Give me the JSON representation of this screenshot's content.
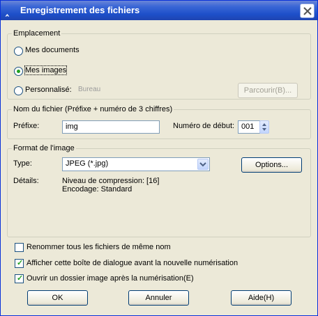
{
  "window": {
    "title": "Enregistrement des fichiers"
  },
  "location": {
    "legend": "Emplacement",
    "options": [
      {
        "label": "Mes documents",
        "checked": false
      },
      {
        "label": "Mes images",
        "checked": true
      },
      {
        "label": "Personnalisé:",
        "checked": false
      }
    ],
    "custom_path": "Bureau",
    "browse_button": "Parcourir(B)..."
  },
  "filename": {
    "legend": "Nom du fichier (Préfixe + numéro de 3 chiffres)",
    "prefix_label": "Préfixe:",
    "prefix_value": "img",
    "start_label": "Numéro de début:",
    "start_value": "001"
  },
  "format": {
    "legend": "Format de l'image",
    "type_label": "Type:",
    "type_value": "JPEG (*.jpg)",
    "options_button": "Options...",
    "details_label": "Détails:",
    "details_line1": "Niveau de compression: [16]",
    "details_line2": "Encodage: Standard"
  },
  "checkboxes": [
    {
      "label": "Renommer tous les fichiers de même nom",
      "checked": false
    },
    {
      "label": "Afficher cette boîte de dialogue avant la nouvelle numérisation",
      "checked": true
    },
    {
      "label": "Ouvrir un dossier image après la numérisation(E)",
      "checked": true
    }
  ],
  "buttons": {
    "ok": "OK",
    "cancel": "Annuler",
    "help": "Aide(H)"
  }
}
